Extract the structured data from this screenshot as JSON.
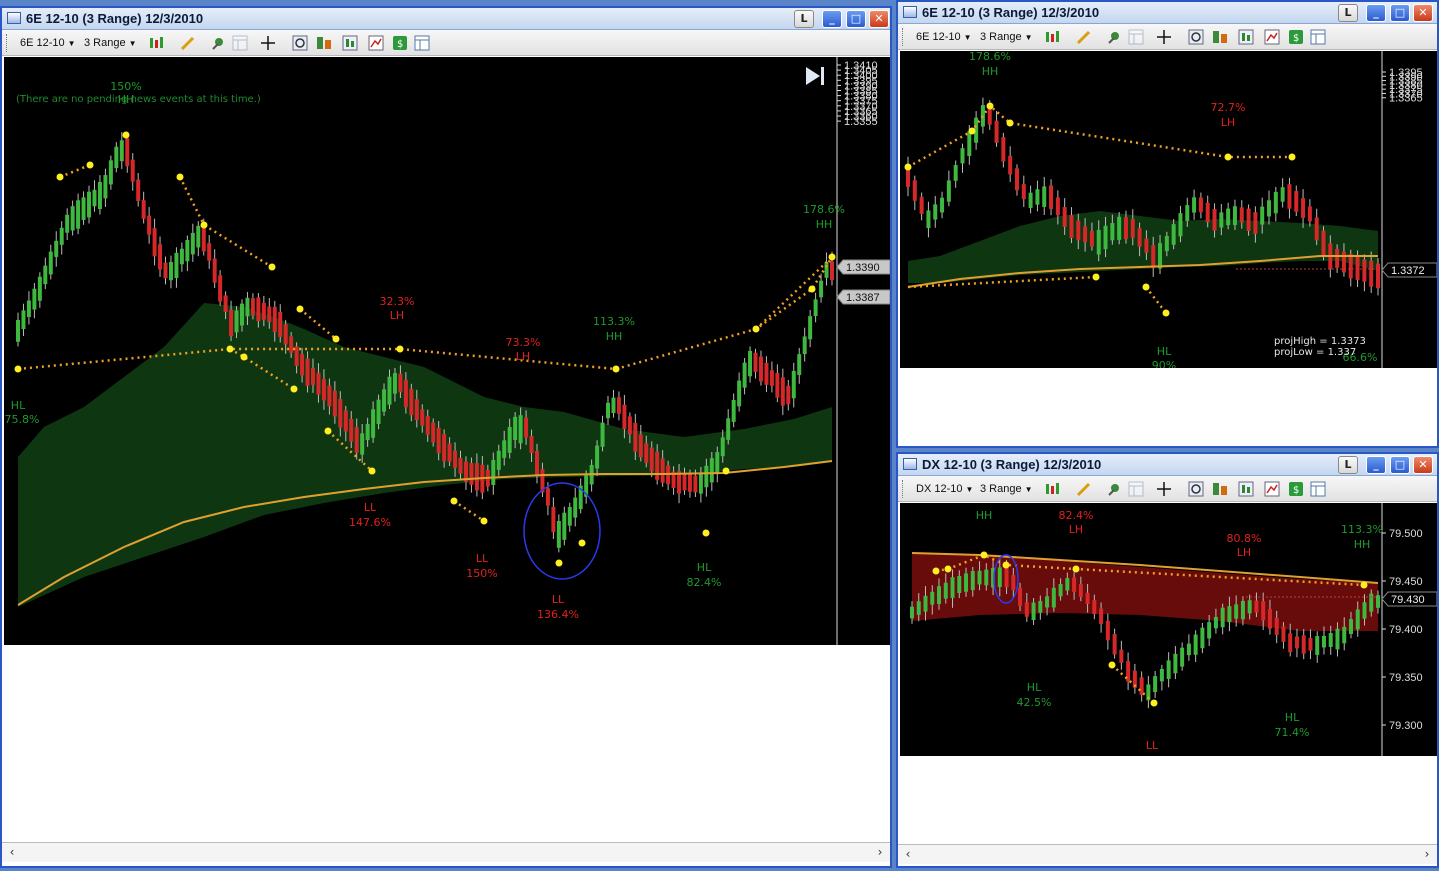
{
  "windows": [
    {
      "title": "6E 12-10 (3 Range)  12/3/2010",
      "instrument": "6E 12-10",
      "period": "3 Range",
      "buttons": {
        "lock": "L"
      },
      "news": "(There are no pending news events at this time.)",
      "price_tags": [
        "1.3390",
        "1.3387"
      ],
      "axis_ticks": [
        "1.3410",
        "1.3405",
        "1.3400",
        "1.3395",
        "1.3390",
        "1.3385",
        "1.3380",
        "1.3375",
        "1.3370",
        "1.3365",
        "1.3360",
        "1.3355"
      ],
      "labels": [
        {
          "text": "150%",
          "color": "green"
        },
        {
          "text": "HH",
          "color": "green"
        },
        {
          "text": "HL",
          "color": "green"
        },
        {
          "text": "75.8%",
          "color": "green"
        },
        {
          "text": "32.3%",
          "color": "red"
        },
        {
          "text": "LH",
          "color": "red"
        },
        {
          "text": "73.3%",
          "color": "red"
        },
        {
          "text": "LH",
          "color": "red"
        },
        {
          "text": "113.3%",
          "color": "green"
        },
        {
          "text": "HH",
          "color": "green"
        },
        {
          "text": "178.6%",
          "color": "green"
        },
        {
          "text": "HH",
          "color": "green"
        },
        {
          "text": "LL",
          "color": "red"
        },
        {
          "text": "147.6%",
          "color": "red"
        },
        {
          "text": "LL",
          "color": "red"
        },
        {
          "text": "150%",
          "color": "red"
        },
        {
          "text": "LL",
          "color": "red"
        },
        {
          "text": "136.4%",
          "color": "red"
        },
        {
          "text": "HL",
          "color": "green"
        },
        {
          "text": "82.4%",
          "color": "green"
        }
      ]
    },
    {
      "title": "6E 12-10 (3 Range)  12/3/2010",
      "instrument": "6E 12-10",
      "period": "3 Range",
      "buttons": {
        "lock": "L"
      },
      "price_tags": [
        "1.3372"
      ],
      "axis_ticks": [
        "1.3395",
        "1.3390",
        "1.3385",
        "1.3380",
        "1.3375",
        "1.3370",
        "1.3365"
      ],
      "proj": [
        "projHigh = 1.3373",
        "projLow = 1.337"
      ],
      "labels": [
        {
          "text": "178.6%",
          "color": "green"
        },
        {
          "text": "HH",
          "color": "green"
        },
        {
          "text": "72.7%",
          "color": "red"
        },
        {
          "text": "LH",
          "color": "red"
        },
        {
          "text": "HL",
          "color": "green"
        },
        {
          "text": "90%",
          "color": "green"
        },
        {
          "text": "66.6%",
          "color": "green"
        }
      ]
    },
    {
      "title": "DX 12-10 (3 Range)  12/3/2010",
      "instrument": "DX 12-10",
      "period": "3 Range",
      "buttons": {
        "lock": "L"
      },
      "price_tags": [
        "79.430"
      ],
      "axis_ticks": [
        "79.500",
        "79.450",
        "79.400",
        "79.350",
        "79.300"
      ],
      "labels": [
        {
          "text": "HH",
          "color": "green"
        },
        {
          "text": "82.4%",
          "color": "red"
        },
        {
          "text": "LH",
          "color": "red"
        },
        {
          "text": "80.8%",
          "color": "red"
        },
        {
          "text": "LH",
          "color": "red"
        },
        {
          "text": "113.3%",
          "color": "green"
        },
        {
          "text": "HH",
          "color": "green"
        },
        {
          "text": "HL",
          "color": "green"
        },
        {
          "text": "42.5%",
          "color": "green"
        },
        {
          "text": "HL",
          "color": "green"
        },
        {
          "text": "71.4%",
          "color": "green"
        },
        {
          "text": "LL",
          "color": "red"
        }
      ]
    }
  ],
  "colors": {
    "up": "#3fb83f",
    "down": "#d62828",
    "cloud_green": "#0f3a12",
    "cloud_red": "#6e0c0c",
    "ma": "#e0a030",
    "swing": "#f0a020",
    "dot": "#ffee22",
    "label_green": "#1e9a2e",
    "label_red": "#e02020"
  },
  "icons": [
    "candlestick-icon",
    "pencil-icon",
    "marker-icon",
    "crosshair-icon",
    "zoom-icon",
    "strategy-icon",
    "indicator-icon",
    "properties-icon",
    "dollar-icon",
    "data-box-icon"
  ]
}
